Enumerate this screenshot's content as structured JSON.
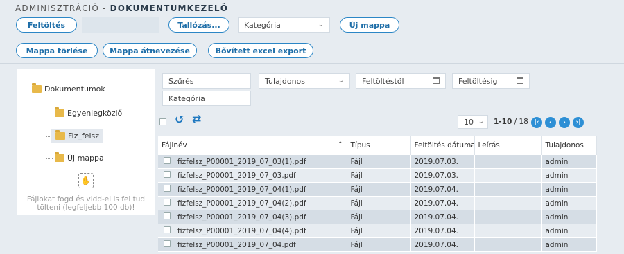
{
  "breadcrumb": {
    "parent": "ADMINISZTRÁCIÓ -",
    "current": "DOKUMENTUMKEZELŐ"
  },
  "toolbar": {
    "upload_label": "Feltöltés",
    "browse_label": "Tallózás...",
    "category_value": "Kategória",
    "new_folder_label": "Új mappa",
    "delete_folder_label": "Mappa törlése",
    "rename_folder_label": "Mappa átnevezése",
    "excel_export_label": "Bővített excel export"
  },
  "tree": {
    "root": "Dokumentumok",
    "children": [
      "Egyenlegközlő",
      "Fiz_felsz",
      "Új mappa"
    ],
    "selected": "Fiz_felsz",
    "drop_hint": "Fájlokat fogd és vidd-el is fel tud tölteni (legfeljebb 100 db)!"
  },
  "filters": {
    "search_placeholder": "Szűrés",
    "owner_value": "Tulajdonos",
    "from_placeholder": "Feltöltéstől",
    "to_placeholder": "Feltöltésig",
    "category_placeholder": "Kategória"
  },
  "pagination": {
    "page_size": "10",
    "range": "1-10",
    "total": "/ 18"
  },
  "grid": {
    "columns": [
      "Fájlnév",
      "Típus",
      "Feltöltés dátuma",
      "Leírás",
      "Tulajdonos"
    ],
    "rows": [
      {
        "name": "fizfelsz_P00001_2019_07_03(1).pdf",
        "type": "Fájl",
        "date": "2019.07.03.",
        "desc": "",
        "owner": "admin"
      },
      {
        "name": "fizfelsz_P00001_2019_07_03.pdf",
        "type": "Fájl",
        "date": "2019.07.03.",
        "desc": "",
        "owner": "admin"
      },
      {
        "name": "fizfelsz_P00001_2019_07_04(1).pdf",
        "type": "Fájl",
        "date": "2019.07.04.",
        "desc": "",
        "owner": "admin"
      },
      {
        "name": "fizfelsz_P00001_2019_07_04(2).pdf",
        "type": "Fájl",
        "date": "2019.07.04.",
        "desc": "",
        "owner": "admin"
      },
      {
        "name": "fizfelsz_P00001_2019_07_04(3).pdf",
        "type": "Fájl",
        "date": "2019.07.04.",
        "desc": "",
        "owner": "admin"
      },
      {
        "name": "fizfelsz_P00001_2019_07_04(4).pdf",
        "type": "Fájl",
        "date": "2019.07.04.",
        "desc": "",
        "owner": "admin"
      },
      {
        "name": "fizfelsz_P00001_2019_07_04.pdf",
        "type": "Fájl",
        "date": "2019.07.04.",
        "desc": "",
        "owner": "admin"
      }
    ]
  }
}
